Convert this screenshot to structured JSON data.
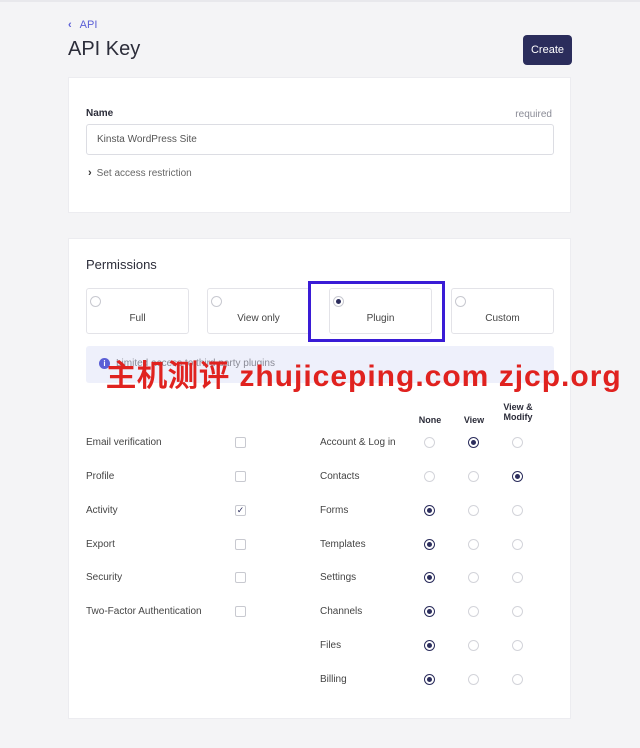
{
  "header": {
    "back_label": "API",
    "title": "API Key",
    "create_label": "Create"
  },
  "name_card": {
    "label": "Name",
    "required": "required",
    "value": "Kinsta WordPress Site",
    "access_label": "Set access restriction"
  },
  "permissions": {
    "title": "Permissions",
    "options": [
      {
        "label": "Full",
        "selected": false
      },
      {
        "label": "View only",
        "selected": false
      },
      {
        "label": "Plugin",
        "selected": true
      },
      {
        "label": "Custom",
        "selected": false
      }
    ],
    "info_text": "Limited access to third party plugins",
    "watermark": "主机测评  zhujiceping.com  zjcp.org",
    "left_items": [
      {
        "label": "Email verification",
        "checked": false
      },
      {
        "label": "Profile",
        "checked": false
      },
      {
        "label": "Activity",
        "checked": true
      },
      {
        "label": "Export",
        "checked": false
      },
      {
        "label": "Security",
        "checked": false
      },
      {
        "label": "Two-Factor Authentication",
        "checked": false
      }
    ],
    "columns": [
      "None",
      "View",
      "View & Modify"
    ],
    "right_items": [
      {
        "label": "Account & Log in",
        "level": "View"
      },
      {
        "label": "Contacts",
        "level": "View & Modify"
      },
      {
        "label": "Forms",
        "level": "None"
      },
      {
        "label": "Templates",
        "level": "None"
      },
      {
        "label": "Settings",
        "level": "None"
      },
      {
        "label": "Channels",
        "level": "None"
      },
      {
        "label": "Files",
        "level": "None"
      },
      {
        "label": "Billing",
        "level": "None"
      }
    ]
  },
  "colors": {
    "accent": "#5b5fd6",
    "primary_button": "#2b2d5c",
    "highlight_box": "#3a1cd6",
    "watermark": "#e0221f"
  }
}
